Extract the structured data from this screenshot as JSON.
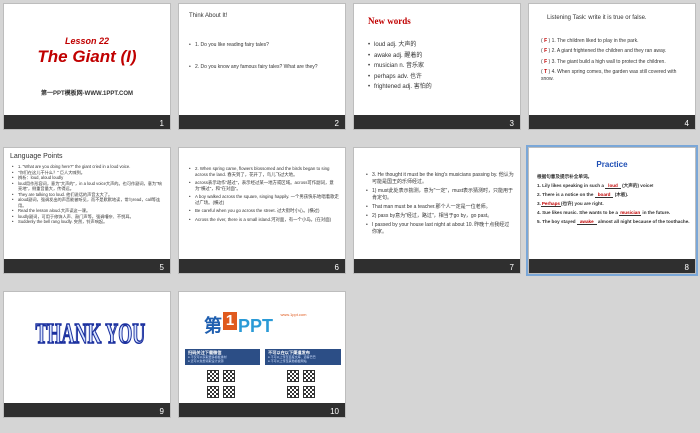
{
  "slides": [
    {
      "num": "1",
      "lesson": "Lesson 22",
      "title": "The Giant (I)",
      "site": "第一PPT模板网-WWW.1PPT.COM"
    },
    {
      "num": "2",
      "heading": "Think About It!",
      "items": [
        "1. Do you like reading fairy tales?",
        "2. Do you know any famous fairy tales? What are they?"
      ]
    },
    {
      "num": "3",
      "heading": "New words",
      "items": [
        "loud adj. 大声的",
        "awake adj. 醒着的",
        "musician n. 音乐家",
        "perhaps adv. 也许",
        "frightened adj. 害怕的"
      ]
    },
    {
      "num": "4",
      "heading": "Listening Task:  write  it is true or false.",
      "items": [
        {
          "mark": "F",
          "text": "1. The children liked to play in the park."
        },
        {
          "mark": "F",
          "text": "2. A giant frightened the children and they ran away."
        },
        {
          "mark": "F",
          "text": "3. The giant build a high wall to protect the children."
        },
        {
          "mark": "T",
          "text": "4. When spring comes, the garden was still covered with snow."
        }
      ]
    },
    {
      "num": "5",
      "heading": "Language Points",
      "items": [
        "1. \"What are you doing here?\" the giant cried in a loud voice.",
        "\"你们在这儿干什么？\" 巨人大喊到。",
        "辨析：loud, aloud loudly",
        "loud用作形容词，意为\"大声的\"，in a loud voice大声的。也可作副词，意为\"响亮地\"，侧重音量大，传得远。",
        "They are talking too loud. 他们说话的声音太大了。",
        "aloud副词，强调发出的声音能被听见，而不是默默地读，常与read，call等连用。",
        "Read the lesson aloud.大声读这一课。",
        "loudly副词，可用于修饰人声、敲门声等，强调嘈杂、不悦耳。",
        "Suddenly the bell rang loudly. 突然，铃声响起。"
      ]
    },
    {
      "num": "6",
      "items": [
        "2. When spring came, flowers blossomed and the birds began to sing across the land. 春天到了，花开了，鸟儿飞过大地。",
        "across表示动作\"越过\"，表示经过某一地方或区域。across可作副词，意为\"横过\"，和\"在对面\"。",
        "A boy walked across the square, singing happily. 一个男孩快乐地唱着歌走过广场。(横过)",
        "Be careful when you go across the street. 过大街时小心。(横过)",
        "Across the river, there is a small island.河对面，有一个小岛。(在对面)"
      ]
    },
    {
      "num": "7",
      "items": [
        "3. He thought it must be the king's musicians passing by. 他认为可能是国王的乐师经过。",
        "1) must此处表示揣测，意为\"一定\"，must表示猜测时，只能用于肯定句。",
        "That man must be a teacher.那个人一定是一位老师。",
        "2) pass by意为\"经过，路过\"，相当于go by，go past。",
        "I passed by your house last night at about 10. 昨晚十点我经过你家。"
      ]
    },
    {
      "num": "8",
      "heading": "Practice",
      "intro": "根据句意及提示补全单词。",
      "items": [
        {
          "before": "1. Lily likes speaking in such a ",
          "blank": "loud",
          "after": " (大声的) voice!"
        },
        {
          "before": "2. There is a notice on the ",
          "blank": "board",
          "after": " (木板)."
        },
        {
          "before": "3.",
          "blank": "Perhaps",
          "after": "(也许) you are right."
        },
        {
          "before": "4. Sue likes music. She wants to be a ",
          "blank": "musician",
          "after": " in the future."
        },
        {
          "before": "5. The boy stayed ",
          "blank": "awake",
          "after": " almost all night because of the toothache."
        }
      ]
    },
    {
      "num": "9",
      "text": "THANK YOU"
    },
    {
      "num": "10",
      "logo_main": "第",
      "logo_one": "1",
      "logo_ppt": "PPT",
      "logo_sub": "www.1ppt.com",
      "left_head": "扫码关注下载微信",
      "right_head": "不可以在以下渠道发布",
      "left_lines": [
        "● 不仅可以获取更多模板素材",
        "● 还可以免费领取设计资源"
      ],
      "right_lines": [
        "● 不可以上传至百度文库、道客巴巴",
        "● 不可以上传至其他模板网站"
      ]
    }
  ],
  "colors": {
    "accent_red": "#c00000",
    "blue": "#0033cc",
    "practice_title": "#1f4fb5",
    "footer": "#2f2f2f"
  }
}
